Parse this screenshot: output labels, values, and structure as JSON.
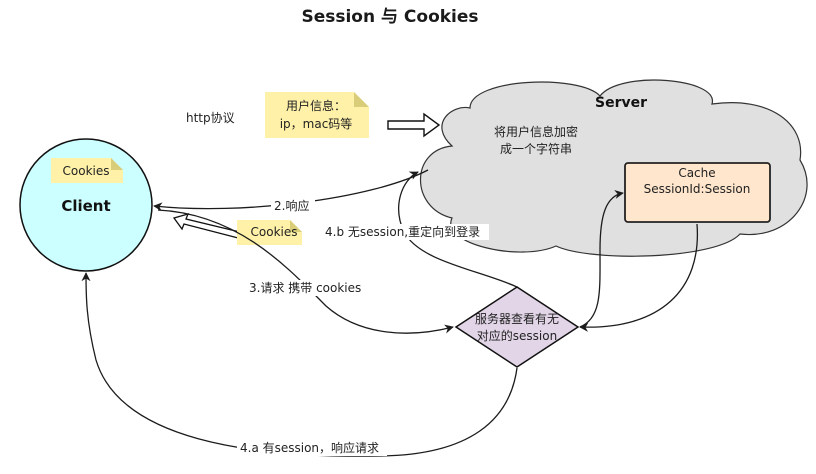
{
  "title": "Session 与 Cookies",
  "nodes": {
    "client": {
      "label": "Client",
      "cookie_note": "Cookies"
    },
    "server": {
      "label": "Server",
      "desc_line1": "将用户信息加密",
      "desc_line2": "成一个字符串"
    },
    "cache": {
      "line1": "Cache",
      "line2": "SessionId:Session"
    },
    "decision": {
      "line1": "服务器查看有无",
      "line2": "对应的session"
    },
    "user_info_note": {
      "line1": "用户信息：",
      "line2": "ip，mac码等"
    },
    "request_cookie_note": {
      "label": "Cookies"
    },
    "http_label": "http协议"
  },
  "edges": {
    "response": "2.响应",
    "request_with_cookies": "3.请求 携带 cookies",
    "no_session_redirect": "4.b 无session,重定向到登录",
    "has_session_respond": "4.a 有session，响应请求"
  },
  "colors": {
    "client_fill": "#ccffff",
    "server_fill": "#e0e0e0",
    "cache_fill": "#ffe6cc",
    "decision_fill": "#e1d5e7",
    "note_fill": "#fff2a8"
  }
}
